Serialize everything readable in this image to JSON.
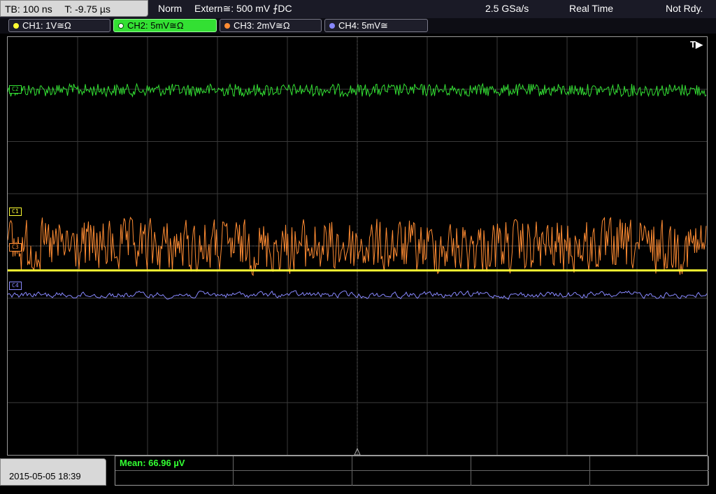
{
  "toolbar": {
    "timebase": "TB: 100 ns",
    "trigger_time": "T: -9.75 µs",
    "mode": "Norm",
    "trigger": "Extern≅: 500 mV ⨍DC",
    "sample_rate": "2.5 GSa/s",
    "acq_mode": "Real Time",
    "status": "Not Rdy."
  },
  "channels": [
    {
      "label": "CH1: 1V≅Ω",
      "color": "#ffff33",
      "active": false
    },
    {
      "label": "CH2: 5mV≅Ω",
      "color": "#33e033",
      "active": true
    },
    {
      "label": "CH3: 2mV≅Ω",
      "color": "#ff8c33",
      "active": false
    },
    {
      "label": "CH4: 5mV≅",
      "color": "#8888ff",
      "active": false
    }
  ],
  "markers": {
    "c1": "C1",
    "c2": "C2",
    "c3": "C3",
    "c4": "C4"
  },
  "trigger_marker": "T▶",
  "date": "2015-05-05 18:39",
  "measurement": {
    "mean": "Mean: 66.96 µV"
  },
  "colors": {
    "ch1": "#ffff33",
    "ch2": "#33e033",
    "ch3": "#ff8c33",
    "ch4": "#8888ff",
    "grid": "#3a3a3a"
  }
}
